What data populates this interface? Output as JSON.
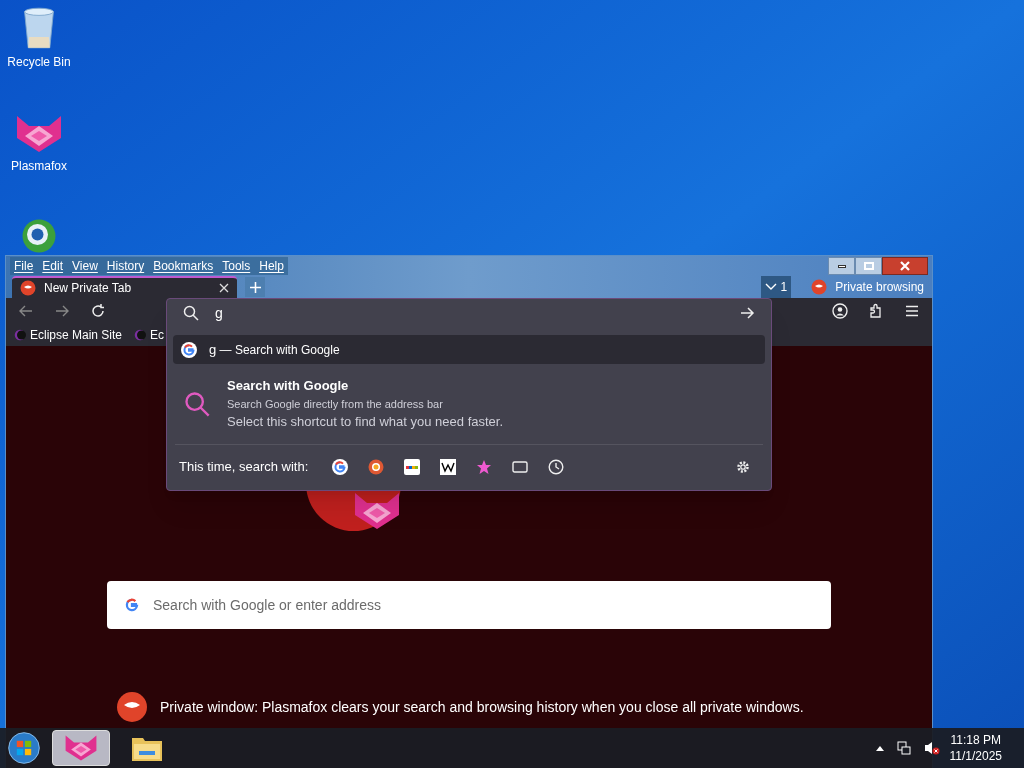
{
  "desktop_icons": [
    {
      "label": "Recycle Bin",
      "kind": "bin"
    },
    {
      "label": "Plasmafox",
      "kind": "fox"
    }
  ],
  "window": {
    "menu": [
      "File",
      "Edit",
      "View",
      "History",
      "Bookmarks",
      "Tools",
      "Help"
    ],
    "tabs": [
      {
        "label": "New Private Tab",
        "selected": true
      }
    ],
    "tab_count": "1",
    "private_label": "Private browsing",
    "url_value": "g",
    "bookmarks": [
      "Eclipse Main Site",
      "Ec"
    ],
    "results": [
      {
        "query": "g",
        "action": "— Search with Google",
        "selected": true
      }
    ],
    "tip": {
      "title": "Search with Google",
      "subtitle": "Search Google directly from the address bar",
      "body": "Select this shortcut to find what you need faster."
    },
    "one_off_label": "This time, search with:",
    "engines": [
      {
        "kind": "google"
      },
      {
        "kind": "duck"
      },
      {
        "kind": "ebay"
      },
      {
        "kind": "wiki"
      },
      {
        "kind": "bookmarks"
      },
      {
        "kind": "tabs"
      },
      {
        "kind": "history"
      }
    ],
    "search_placeholder": "Search with Google or enter address",
    "notice": "Private window: Plasmafox clears your search and browsing history when you close all private windows."
  },
  "taskbar": {
    "apps": [
      {
        "kind": "fox",
        "selected": true
      },
      {
        "kind": "folder",
        "selected": false
      }
    ],
    "time": "11:18 PM",
    "date": "11/1/2025"
  }
}
